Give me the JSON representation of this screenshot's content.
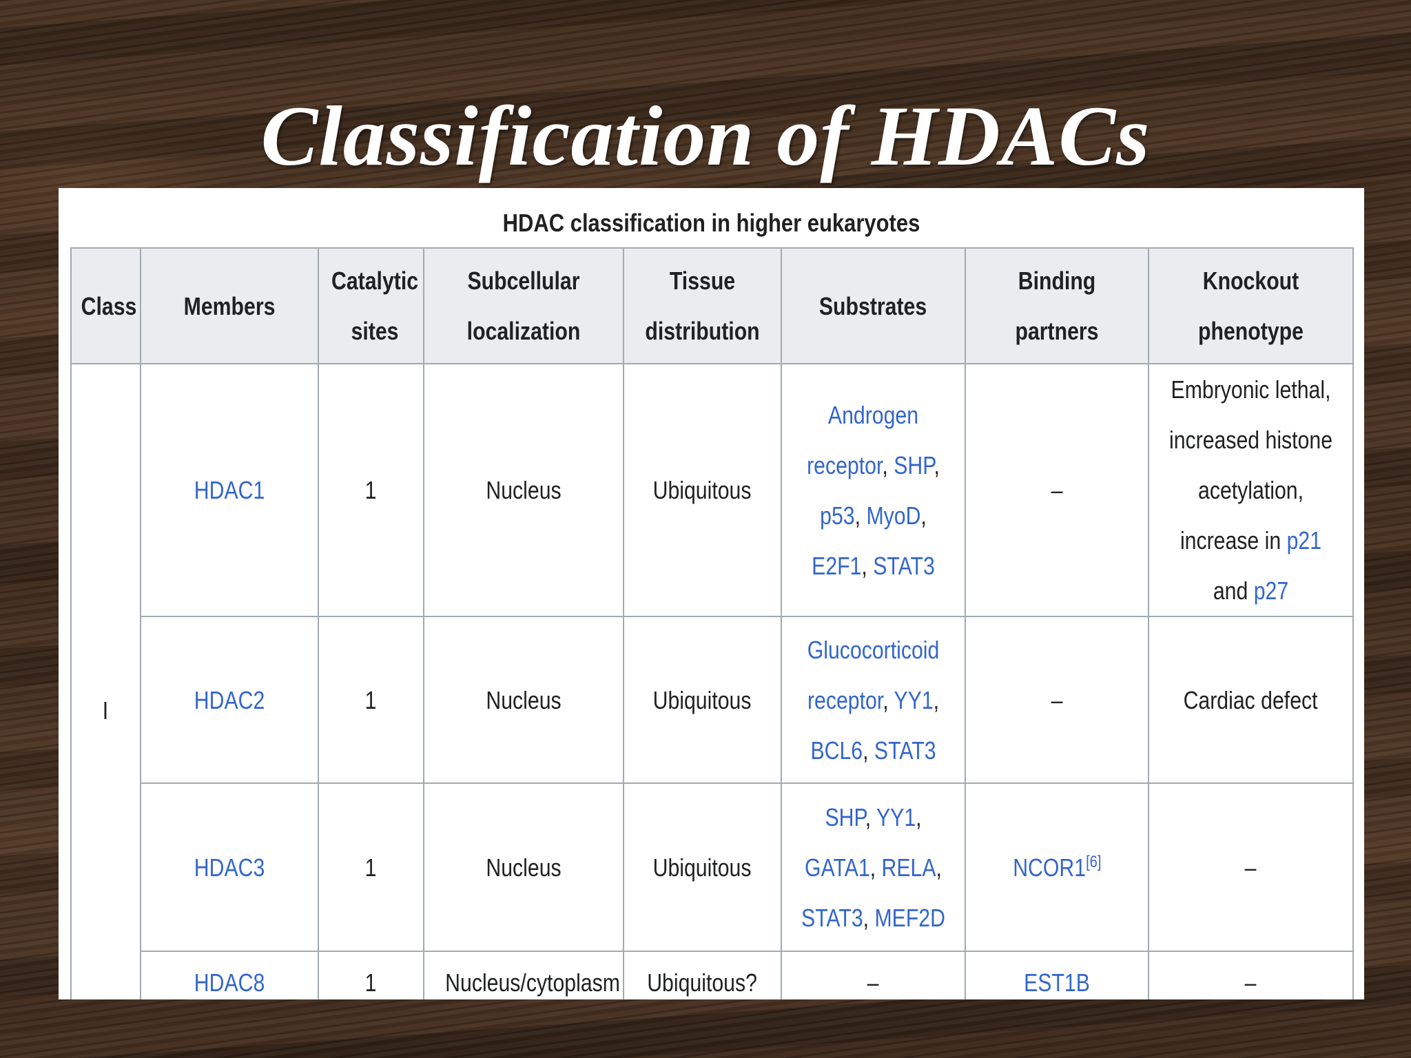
{
  "slide": {
    "title": "Classification of HDACs"
  },
  "table": {
    "caption": "HDAC classification in higher eukaryotes",
    "headers": {
      "class": "Class",
      "members": "Members",
      "catalytic_sites": "Catalytic sites",
      "subcellular_localization": "Subcellular localization",
      "tissue_distribution": "Tissue distribution",
      "substrates": "Substrates",
      "binding_partners": "Binding partners",
      "knockout_phenotype": "Knockout phenotype"
    },
    "class_value": "I",
    "rows": [
      {
        "member": "HDAC1",
        "catalytic_sites": "1",
        "localization": "Nucleus",
        "tissue": "Ubiquitous",
        "substrates": {
          "s1": "Androgen receptor",
          "sep1": ", ",
          "s2": "SHP",
          "sep2": ", ",
          "s3": "p53",
          "sep3": ", ",
          "s4": "MyoD",
          "sep4": ", ",
          "s5": "E2F1",
          "sep5": ", ",
          "s6": "STAT3"
        },
        "binding_partners": "–",
        "knockout": {
          "text1": "Embryonic lethal, increased histone acetylation, increase in ",
          "link1": "p21",
          "text2": " and ",
          "link2": "p27"
        }
      },
      {
        "member": "HDAC2",
        "catalytic_sites": "1",
        "localization": "Nucleus",
        "tissue": "Ubiquitous",
        "substrates": {
          "s1": "Glucocorticoid receptor",
          "sep1": ", ",
          "s2": "YY1",
          "sep2": ", ",
          "s3": "BCL6",
          "sep3": ", ",
          "s4": "STAT3"
        },
        "binding_partners": "–",
        "knockout": "Cardiac defect"
      },
      {
        "member": "HDAC3",
        "catalytic_sites": "1",
        "localization": "Nucleus",
        "tissue": "Ubiquitous",
        "substrates": {
          "s1": "SHP",
          "sep1": ", ",
          "s2": "YY1",
          "sep2": ", ",
          "s3": "GATA1",
          "sep3": ", ",
          "s4": "RELA",
          "sep4": ", ",
          "s5": "STAT3",
          "sep5": ", ",
          "s6": "MEF2D"
        },
        "binding_partners": "NCOR1",
        "binding_partners_ref": "[6]",
        "knockout": "–"
      },
      {
        "member": "HDAC8",
        "catalytic_sites": "1",
        "localization": "Nucleus/cytoplasm",
        "tissue": "Ubiquitous?",
        "substrates": "–",
        "binding_partners": "EST1B",
        "knockout": "–"
      }
    ]
  },
  "colors": {
    "link": "#3366cc",
    "header_bg": "#eaecf0",
    "border": "#a2a9b1",
    "text": "#202122",
    "title": "#ffffff",
    "background": "dark wood"
  }
}
